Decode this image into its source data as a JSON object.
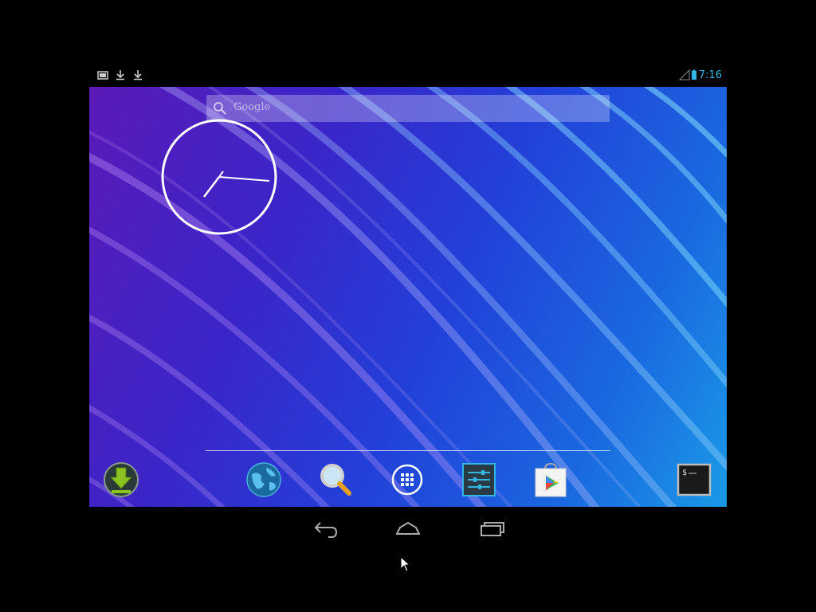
{
  "status_bar": {
    "time": "7:16",
    "notification_icons": [
      "screenshot-icon",
      "download-icon",
      "download-icon"
    ],
    "system_icons": [
      "signal-icon",
      "battery-icon"
    ],
    "accent_color": "#33b5e5"
  },
  "search": {
    "placeholder": "Google"
  },
  "dock": {
    "items": [
      {
        "name": "download-app-icon"
      },
      {
        "name": "browser-globe-icon"
      },
      {
        "name": "search-app-icon"
      },
      {
        "name": "all-apps-icon"
      },
      {
        "name": "settings-app-icon"
      },
      {
        "name": "play-store-icon"
      },
      {
        "name": "terminal-app-icon"
      }
    ]
  },
  "nav_bar": {
    "buttons": [
      "back-icon",
      "home-icon",
      "recent-apps-icon"
    ]
  }
}
